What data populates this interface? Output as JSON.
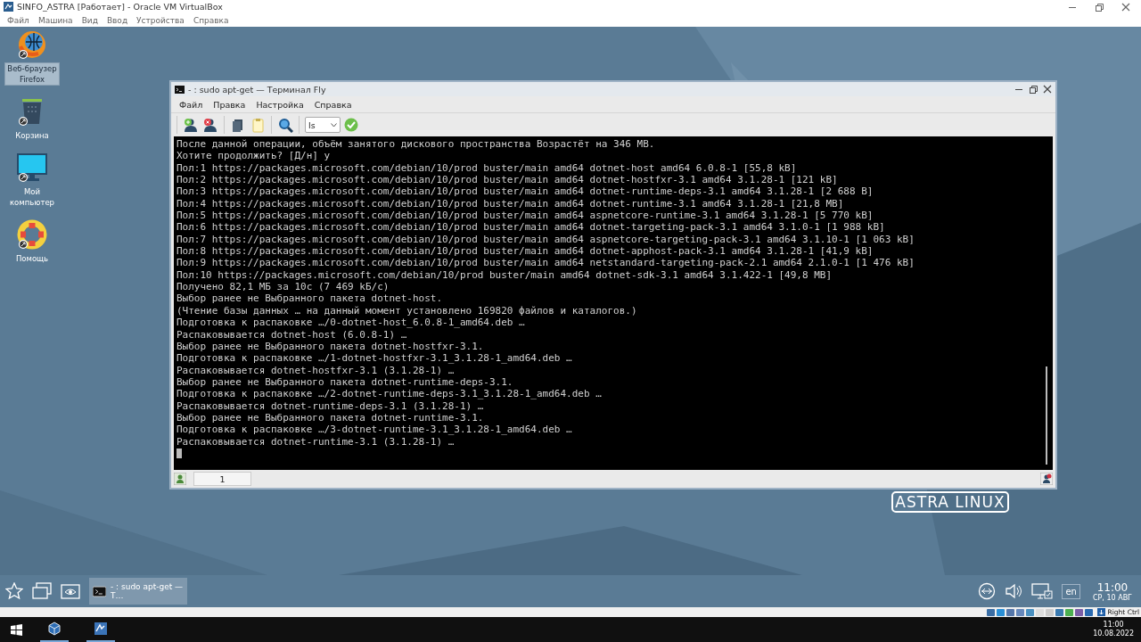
{
  "vbox": {
    "title": "SINFO_ASTRA [Работает] - Oracle VM VirtualBox",
    "menu": [
      "Файл",
      "Машина",
      "Вид",
      "Ввод",
      "Устройства",
      "Справка"
    ],
    "host_key": "Right Ctrl"
  },
  "desktop": {
    "icons": [
      {
        "label": "Веб-браузер Firefox",
        "kind": "firefox",
        "selected": true
      },
      {
        "label": "Корзина",
        "kind": "trash",
        "selected": false
      },
      {
        "label": "Мой компьютер",
        "kind": "computer",
        "selected": false
      },
      {
        "label": "Помощь",
        "kind": "help",
        "selected": false
      }
    ],
    "logo": "ASTRA LINUX"
  },
  "terminal": {
    "title": "- : sudo apt-get — Терминал Fly",
    "menu": [
      "Файл",
      "Правка",
      "Настройка",
      "Справка"
    ],
    "command_combo": "ls",
    "lines": [
      "После данной операции, объём занятого дискового пространства Возрастёт на 346 МВ.",
      "Хотите продолжить? [Д/н] y",
      "Пол:1 https://packages.microsoft.com/debian/10/prod buster/main amd64 dotnet-host amd64 6.0.8-1 [55,8 kB]",
      "Пол:2 https://packages.microsoft.com/debian/10/prod buster/main amd64 dotnet-hostfxr-3.1 amd64 3.1.28-1 [121 kB]",
      "Пол:3 https://packages.microsoft.com/debian/10/prod buster/main amd64 dotnet-runtime-deps-3.1 amd64 3.1.28-1 [2 688 B]",
      "Пол:4 https://packages.microsoft.com/debian/10/prod buster/main amd64 dotnet-runtime-3.1 amd64 3.1.28-1 [21,8 MB]",
      "Пол:5 https://packages.microsoft.com/debian/10/prod buster/main amd64 aspnetcore-runtime-3.1 amd64 3.1.28-1 [5 770 kB]",
      "Пол:6 https://packages.microsoft.com/debian/10/prod buster/main amd64 dotnet-targeting-pack-3.1 amd64 3.1.0-1 [1 988 kB]",
      "Пол:7 https://packages.microsoft.com/debian/10/prod buster/main amd64 aspnetcore-targeting-pack-3.1 amd64 3.1.10-1 [1 063 kB]",
      "Пол:8 https://packages.microsoft.com/debian/10/prod buster/main amd64 dotnet-apphost-pack-3.1 amd64 3.1.28-1 [41,9 kB]",
      "Пол:9 https://packages.microsoft.com/debian/10/prod buster/main amd64 netstandard-targeting-pack-2.1 amd64 2.1.0-1 [1 476 kB]",
      "Пол:10 https://packages.microsoft.com/debian/10/prod buster/main amd64 dotnet-sdk-3.1 amd64 3.1.422-1 [49,8 MB]",
      "Получено 82,1 МБ за 10с (7 469 kБ/с)",
      "Выбор ранее не Выбранного пакета dotnet-host.",
      "(Чтение базы данных … на данный момент установлено 169820 файлов и каталогов.)",
      "Подготовка к распаковке …/0-dotnet-host_6.0.8-1_amd64.deb …",
      "Распаковывается dotnet-host (6.0.8-1) …",
      "Выбор ранее не Выбранного пакета dotnet-hostfxr-3.1.",
      "Подготовка к распаковке …/1-dotnet-hostfxr-3.1_3.1.28-1_amd64.deb …",
      "Распаковывается dotnet-hostfxr-3.1 (3.1.28-1) …",
      "Выбор ранее не Выбранного пакета dotnet-runtime-deps-3.1.",
      "Подготовка к распаковке …/2-dotnet-runtime-deps-3.1_3.1.28-1_amd64.deb …",
      "Распаковывается dotnet-runtime-deps-3.1 (3.1.28-1) …",
      "Выбор ранее не Выбранного пакета dotnet-runtime-3.1.",
      "Подготовка к распаковке …/3-dotnet-runtime-3.1_3.1.28-1_amd64.deb …",
      "Распаковывается dotnet-runtime-3.1 (3.1.28-1) …"
    ],
    "tab": "1"
  },
  "taskbar": {
    "tasks": [
      {
        "label": "- : sudo apt-get — T…",
        "selected": true
      }
    ],
    "language": "en",
    "time": "11:00",
    "date": "СР, 10 АВГ"
  },
  "host_taskbar": {
    "time": "11:00",
    "date": "10.08.2022"
  }
}
